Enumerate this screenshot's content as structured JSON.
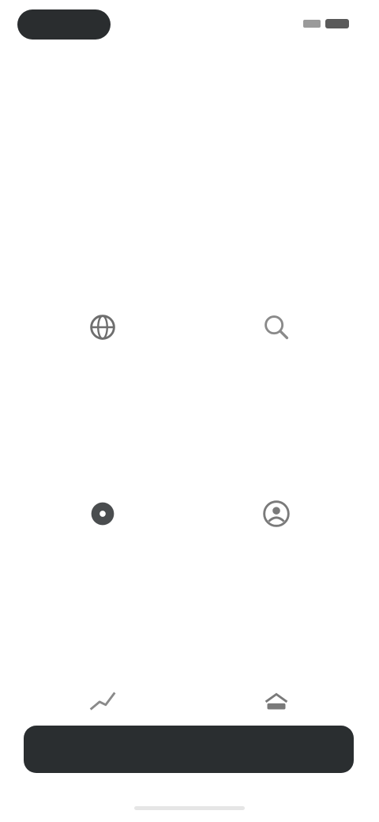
{
  "header": {
    "back_label": "",
    "title": "",
    "action_label": ""
  },
  "hero": {
    "eyebrow": "",
    "headline": "",
    "subhead": ""
  },
  "tiles": [
    {
      "label": "",
      "icon": "globe-icon"
    },
    {
      "label": "",
      "icon": "search-icon"
    },
    {
      "label": "",
      "icon": "disc-icon"
    },
    {
      "label": "",
      "icon": "user-circle-icon"
    },
    {
      "label": "",
      "icon": "trend-line-icon"
    },
    {
      "label": "",
      "icon": "stack-icon"
    }
  ],
  "cta": {
    "label": ""
  },
  "colors": {
    "accent": "#e0b389",
    "dark": "#2a2e30",
    "icon": "#6e6e6e"
  }
}
